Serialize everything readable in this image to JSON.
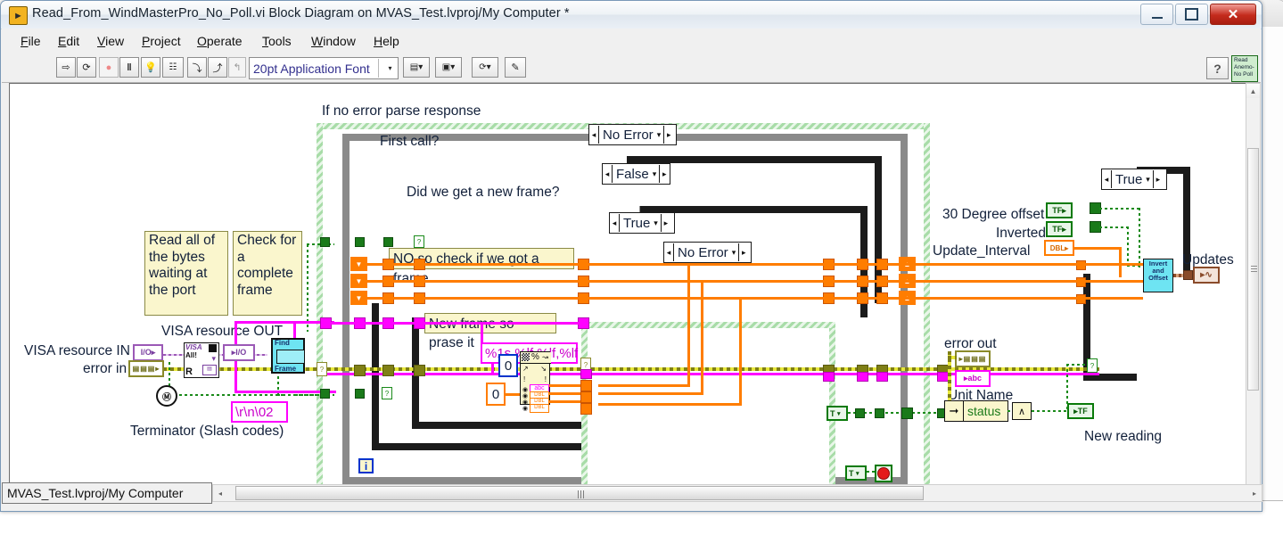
{
  "window": {
    "title": "Read_From_WindMasterPro_No_Poll.vi Block Diagram on MVAS_Test.lvproj/My Computer *",
    "app_icon": "labview-vi-icon",
    "minimize_label": "–",
    "maximize_label": "□",
    "close_label": "✕"
  },
  "menu": {
    "items": [
      {
        "label": "File",
        "accel": "F"
      },
      {
        "label": "Edit",
        "accel": "E"
      },
      {
        "label": "View",
        "accel": "V"
      },
      {
        "label": "Project",
        "accel": "P"
      },
      {
        "label": "Operate",
        "accel": "O"
      },
      {
        "label": "Tools",
        "accel": "T"
      },
      {
        "label": "Window",
        "accel": "W"
      },
      {
        "label": "Help",
        "accel": "H"
      }
    ]
  },
  "toolbar": {
    "run_label": "⇨",
    "run_continuous_label": "⟳",
    "abort_label": "●",
    "pause_label": "‖",
    "highlight_label": "◎",
    "retain_values_label": "⬚",
    "step_into_label": "⤵",
    "step_over_label": "⤴",
    "step_out_label": "↰",
    "font_selector_value": "20pt Application Font",
    "font_dropdown_caret": "▾",
    "align_objects_label": "⦙",
    "distribute_objects_label": "⋮",
    "reorder_label": "⭮",
    "cleanup_diagram_label": "✎",
    "help_button_label": "?",
    "vi_icon_text": "Read Anemo- No Poll"
  },
  "status_bar": {
    "path": "MVAS_Test.lvproj/My Computer",
    "resize_handle": "◂"
  },
  "scrollbars": {
    "vertical": {
      "up": "▲",
      "down": "▼",
      "grip": "≡"
    },
    "horizontal": {
      "left": "◂",
      "right": "▸",
      "grip": "⫼"
    }
  },
  "diagram": {
    "comments": [
      {
        "id": "if-no-error",
        "text": "If no error parse response"
      },
      {
        "id": "first-call",
        "text": "First call?"
      },
      {
        "id": "did-we-get",
        "text": "Did we get a new frame?"
      },
      {
        "id": "read-bytes",
        "text": "Read all of\nthe bytes\nwaiting at\nthe port"
      },
      {
        "id": "check-frame",
        "text": "Check for\na\ncomplete\nframe"
      },
      {
        "id": "no-so-check",
        "text": "NO so check if we got a frame"
      },
      {
        "id": "new-frame",
        "text": "New frame so prase it"
      },
      {
        "id": "terminator",
        "text": "Terminator (Slash codes)"
      },
      {
        "id": "visa-out",
        "text": "VISA resource OUT"
      },
      {
        "id": "visa-in",
        "text": "VISA resource IN"
      },
      {
        "id": "error-in",
        "text": "error in"
      },
      {
        "id": "error-out",
        "text": "error out"
      },
      {
        "id": "unit-name",
        "text": "Unit Name"
      },
      {
        "id": "new-reading",
        "text": "New reading"
      },
      {
        "id": "updates",
        "text": "Updates"
      },
      {
        "id": "deg-offset",
        "text": "30 Degree offset"
      },
      {
        "id": "inverted",
        "text": "Inverted"
      },
      {
        "id": "update-int",
        "text": "Update_Interval"
      }
    ],
    "case_selectors": [
      {
        "id": "outer-error",
        "value": "No Error"
      },
      {
        "id": "first-call",
        "value": "False"
      },
      {
        "id": "new-frame",
        "value": "True"
      },
      {
        "id": "parse-error",
        "value": "No Error"
      },
      {
        "id": "right-true",
        "value": "True"
      }
    ],
    "constants": [
      {
        "id": "terminator-string",
        "value": "\\r\\n\\02"
      },
      {
        "id": "format-string",
        "value": "%1s,%lf,%lf,%lf"
      },
      {
        "id": "scan-offset",
        "value": "0"
      },
      {
        "id": "default-double",
        "value": "0"
      }
    ],
    "terminals": [
      {
        "id": "visa-resource-in",
        "label": "I/O"
      },
      {
        "id": "visa-resource-out",
        "label": "I/O"
      },
      {
        "id": "error-in-term",
        "label": "error"
      },
      {
        "id": "error-out-term",
        "label": "error"
      },
      {
        "id": "unit-name-term",
        "label": "abc"
      },
      {
        "id": "deg-offset-term",
        "label": "TF"
      },
      {
        "id": "inverted-term",
        "label": "TF"
      },
      {
        "id": "update-interval-term",
        "label": "DBL"
      },
      {
        "id": "new-reading-term",
        "label": "TF"
      },
      {
        "id": "updates-term",
        "label": "∿"
      }
    ],
    "subvis": [
      {
        "id": "find-frame",
        "text": "Find\nFrame"
      },
      {
        "id": "invert-offset",
        "text": "Invert\nand\nOffset"
      },
      {
        "id": "visa-read",
        "text": "VISA All!"
      },
      {
        "id": "scan-from-string",
        "text": "%"
      }
    ],
    "structure_extras": {
      "iteration_label": "i",
      "stop_label": "STOP",
      "bool_true_label": "T",
      "unbundle_label": "status",
      "not_gate_label": "∧"
    }
  }
}
